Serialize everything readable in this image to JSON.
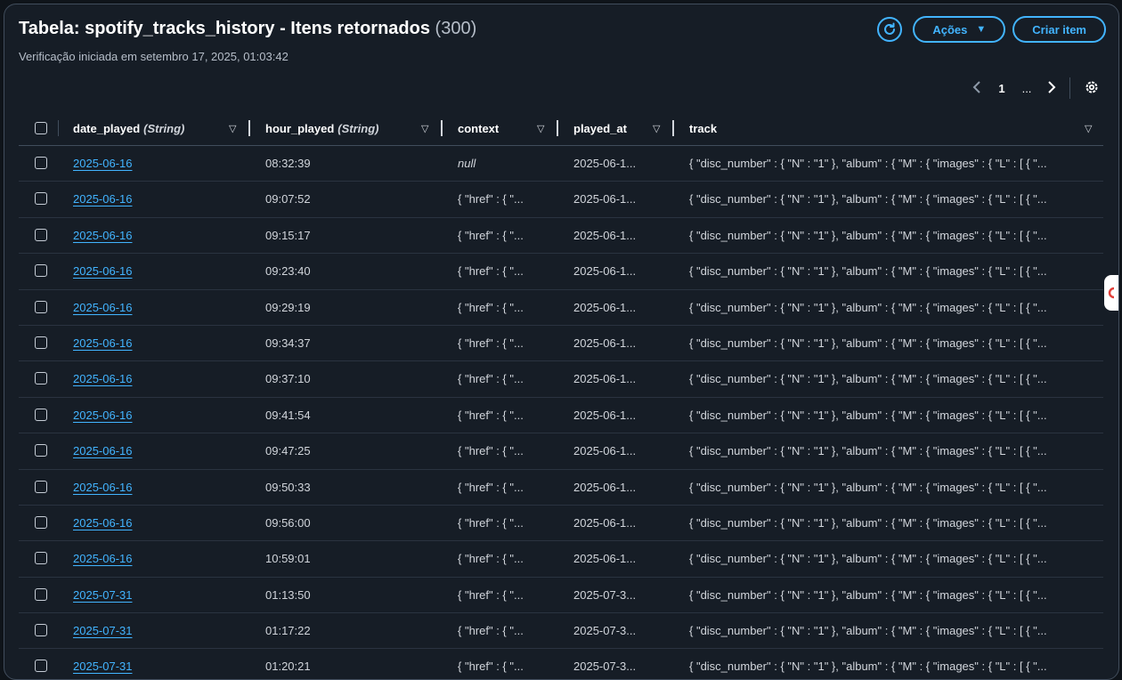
{
  "header": {
    "title": "Tabela: spotify_tracks_history - Itens retornados",
    "count": "(300)",
    "subtitle": "Verificação iniciada em setembro 17, 2025, 01:03:42"
  },
  "toolbar": {
    "actions_label": "Ações",
    "create_label": "Criar item"
  },
  "pagination": {
    "current_page": "1",
    "ellipsis": "..."
  },
  "columns": [
    {
      "name": "date_played",
      "type": "(String)"
    },
    {
      "name": "hour_played",
      "type": "(String)"
    },
    {
      "name": "context",
      "type": ""
    },
    {
      "name": "played_at",
      "type": ""
    },
    {
      "name": "track",
      "type": ""
    }
  ],
  "rows": [
    {
      "date_played": "2025-06-16",
      "hour_played": "08:32:39",
      "context": "null",
      "played_at": "2025-06-1...",
      "track": "{ \"disc_number\" : { \"N\" : \"1\" }, \"album\" : { \"M\" : { \"images\" : { \"L\" : [ { \"..."
    },
    {
      "date_played": "2025-06-16",
      "hour_played": "09:07:52",
      "context": "{ \"href\" : { \"...",
      "played_at": "2025-06-1...",
      "track": "{ \"disc_number\" : { \"N\" : \"1\" }, \"album\" : { \"M\" : { \"images\" : { \"L\" : [ { \"..."
    },
    {
      "date_played": "2025-06-16",
      "hour_played": "09:15:17",
      "context": "{ \"href\" : { \"...",
      "played_at": "2025-06-1...",
      "track": "{ \"disc_number\" : { \"N\" : \"1\" }, \"album\" : { \"M\" : { \"images\" : { \"L\" : [ { \"..."
    },
    {
      "date_played": "2025-06-16",
      "hour_played": "09:23:40",
      "context": "{ \"href\" : { \"...",
      "played_at": "2025-06-1...",
      "track": "{ \"disc_number\" : { \"N\" : \"1\" }, \"album\" : { \"M\" : { \"images\" : { \"L\" : [ { \"..."
    },
    {
      "date_played": "2025-06-16",
      "hour_played": "09:29:19",
      "context": "{ \"href\" : { \"...",
      "played_at": "2025-06-1...",
      "track": "{ \"disc_number\" : { \"N\" : \"1\" }, \"album\" : { \"M\" : { \"images\" : { \"L\" : [ { \"..."
    },
    {
      "date_played": "2025-06-16",
      "hour_played": "09:34:37",
      "context": "{ \"href\" : { \"...",
      "played_at": "2025-06-1...",
      "track": "{ \"disc_number\" : { \"N\" : \"1\" }, \"album\" : { \"M\" : { \"images\" : { \"L\" : [ { \"..."
    },
    {
      "date_played": "2025-06-16",
      "hour_played": "09:37:10",
      "context": "{ \"href\" : { \"...",
      "played_at": "2025-06-1...",
      "track": "{ \"disc_number\" : { \"N\" : \"1\" }, \"album\" : { \"M\" : { \"images\" : { \"L\" : [ { \"..."
    },
    {
      "date_played": "2025-06-16",
      "hour_played": "09:41:54",
      "context": "{ \"href\" : { \"...",
      "played_at": "2025-06-1...",
      "track": "{ \"disc_number\" : { \"N\" : \"1\" }, \"album\" : { \"M\" : { \"images\" : { \"L\" : [ { \"..."
    },
    {
      "date_played": "2025-06-16",
      "hour_played": "09:47:25",
      "context": "{ \"href\" : { \"...",
      "played_at": "2025-06-1...",
      "track": "{ \"disc_number\" : { \"N\" : \"1\" }, \"album\" : { \"M\" : { \"images\" : { \"L\" : [ { \"..."
    },
    {
      "date_played": "2025-06-16",
      "hour_played": "09:50:33",
      "context": "{ \"href\" : { \"...",
      "played_at": "2025-06-1...",
      "track": "{ \"disc_number\" : { \"N\" : \"1\" }, \"album\" : { \"M\" : { \"images\" : { \"L\" : [ { \"..."
    },
    {
      "date_played": "2025-06-16",
      "hour_played": "09:56:00",
      "context": "{ \"href\" : { \"...",
      "played_at": "2025-06-1...",
      "track": "{ \"disc_number\" : { \"N\" : \"1\" }, \"album\" : { \"M\" : { \"images\" : { \"L\" : [ { \"..."
    },
    {
      "date_played": "2025-06-16",
      "hour_played": "10:59:01",
      "context": "{ \"href\" : { \"...",
      "played_at": "2025-06-1...",
      "track": "{ \"disc_number\" : { \"N\" : \"1\" }, \"album\" : { \"M\" : { \"images\" : { \"L\" : [ { \"..."
    },
    {
      "date_played": "2025-07-31",
      "hour_played": "01:13:50",
      "context": "{ \"href\" : { \"...",
      "played_at": "2025-07-3...",
      "track": "{ \"disc_number\" : { \"N\" : \"1\" }, \"album\" : { \"M\" : { \"images\" : { \"L\" : [ { \"..."
    },
    {
      "date_played": "2025-07-31",
      "hour_played": "01:17:22",
      "context": "{ \"href\" : { \"...",
      "played_at": "2025-07-3...",
      "track": "{ \"disc_number\" : { \"N\" : \"1\" }, \"album\" : { \"M\" : { \"images\" : { \"L\" : [ { \"..."
    },
    {
      "date_played": "2025-07-31",
      "hour_played": "01:20:21",
      "context": "{ \"href\" : { \"...",
      "played_at": "2025-07-3...",
      "track": "{ \"disc_number\" : { \"N\" : \"1\" }, \"album\" : { \"M\" : { \"images\" : { \"L\" : [ { \"..."
    }
  ],
  "colors": {
    "accent": "#42b4ff",
    "background": "#161d26",
    "border": "#414d5c"
  }
}
